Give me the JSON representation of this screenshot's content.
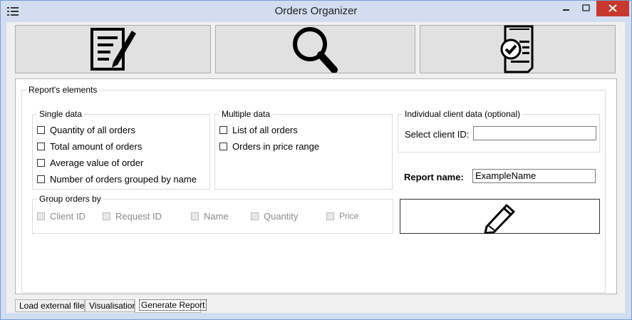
{
  "window": {
    "title": "Orders Organizer"
  },
  "toolbar": {
    "buttons": [
      {
        "icon": "edit-document-icon"
      },
      {
        "icon": "magnifier-icon"
      },
      {
        "icon": "checklist-report-icon"
      }
    ]
  },
  "report_elements": {
    "legend": "Report's elements",
    "single_data": {
      "legend": "Single data",
      "items": [
        "Quantity of all orders",
        "Total amount of orders",
        "Average value of order",
        "Number of orders grouped by name"
      ]
    },
    "multiple_data": {
      "legend": "Multiple data",
      "items": [
        "List of all orders",
        "Orders in price range"
      ]
    },
    "client_data": {
      "legend": "Individual client data (optional)",
      "select_label": "Select client ID:",
      "client_id_value": ""
    },
    "report_name": {
      "label": "Report name:",
      "value": "ExampleName"
    },
    "group_by": {
      "legend": "Group orders by",
      "items": [
        "Client ID",
        "Request ID",
        "Name",
        "Quantity",
        "Price"
      ]
    }
  },
  "tabs": [
    "Load external files",
    "Visualisation",
    "Generate Report"
  ],
  "colors": {
    "close_button": "#c7392f",
    "window_frame": "#d2ddf0"
  }
}
